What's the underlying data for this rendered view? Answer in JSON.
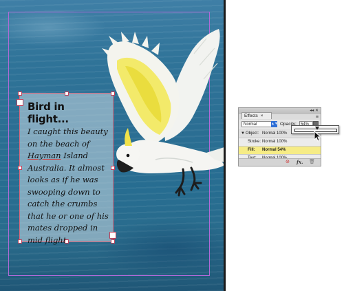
{
  "document": {
    "heading": "Bird in flight...",
    "body_part1": "I caught this beauty on the beach of ",
    "body_spell": "Hayman",
    "body_part2": " Island Australia. It almost looks as if he was swooping down to catch the crumbs that he or one of his mates dropped in mid flight."
  },
  "effects_panel": {
    "tab_label": "Effects",
    "tab_close": "×",
    "titlebar_icons": "◂◂ ✕",
    "menu_icon": "≡",
    "blend_mode": "Normal",
    "opacity_label": "Opacity:",
    "opacity_value": "54%",
    "opacity_fraction": 0.54,
    "rows": [
      {
        "label": "Object:",
        "value": "Normal 100%"
      },
      {
        "label": "Stroke:",
        "value": "Normal 100%"
      },
      {
        "label": "Fill:",
        "value": "Normal 54%"
      },
      {
        "label": "Text:",
        "value": "Normal 100%"
      }
    ],
    "footer_icons": [
      "clear-effects-icon",
      "fx-icon",
      "trash-icon"
    ]
  },
  "colors": {
    "water": "#2b6e93",
    "frame_border": "#d86a7e",
    "guide": "#b06ad8",
    "fill_highlight": "#f6ec86",
    "blend_arrows": "#2f6fd6"
  }
}
